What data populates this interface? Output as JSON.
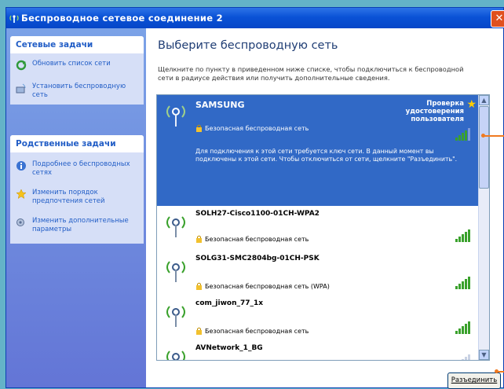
{
  "window": {
    "title": "Беспроводное сетевое соединение 2",
    "close_glyph": "✕"
  },
  "tasks": {
    "network_tasks": {
      "header": "Сетевые задачи",
      "items": [
        {
          "label": "Обновить список сети",
          "icon": "refresh-icon"
        },
        {
          "label": "Установить беспроводную сеть",
          "icon": "wireless-setup-icon"
        }
      ]
    },
    "related_tasks": {
      "header": "Родственные задачи",
      "items": [
        {
          "label": "Подробнее о беспроводных сетях",
          "icon": "info-icon"
        },
        {
          "label": "Изменить порядок предпочтения сетей",
          "icon": "star-icon"
        },
        {
          "label": "Изменить дополнительные параметры",
          "icon": "settings-icon"
        }
      ]
    }
  },
  "main": {
    "heading": "Выберите беспроводную сеть",
    "instructions": "Щелкните по пункту в приведенном ниже списке, чтобы подключиться к беспроводной сети в радиусе действия или получить дополнительные сведения."
  },
  "networks": {
    "selected": {
      "name": "SAMSUNG",
      "security": "Безопасная беспроводная сеть",
      "description": "Для подключения к этой сети требуется ключ сети. В данный момент вы подключены к этой сети. Чтобы отключиться от сети, щелкните \"Разъединить\".",
      "verify_label": "Проверка удостоверения пользователя",
      "signal": 0.8
    },
    "rows": [
      {
        "name": "SOLH27-Cisco1100-01CH-WPA2",
        "security": "Безопасная беспроводная сеть",
        "signal": 1.0
      },
      {
        "name": "SOLG31-SMC2804bg-01CH-PSK",
        "security": "Безопасная беспроводная сеть (WPA)",
        "signal": 1.0
      },
      {
        "name": "com_jiwon_77_1x",
        "security": "Безопасная беспроводная сеть",
        "signal": 1.0
      },
      {
        "name": "AVNetwork_1_BG",
        "security": "",
        "signal": 0.4
      }
    ]
  },
  "buttons": {
    "disconnect": "Разъединить"
  },
  "colors": {
    "title_blue": "#0a52d6",
    "selected_row": "#3169c6",
    "signal_green": "#3aa12c",
    "callout_orange": "#f07a20",
    "link_blue": "#215dc6"
  }
}
